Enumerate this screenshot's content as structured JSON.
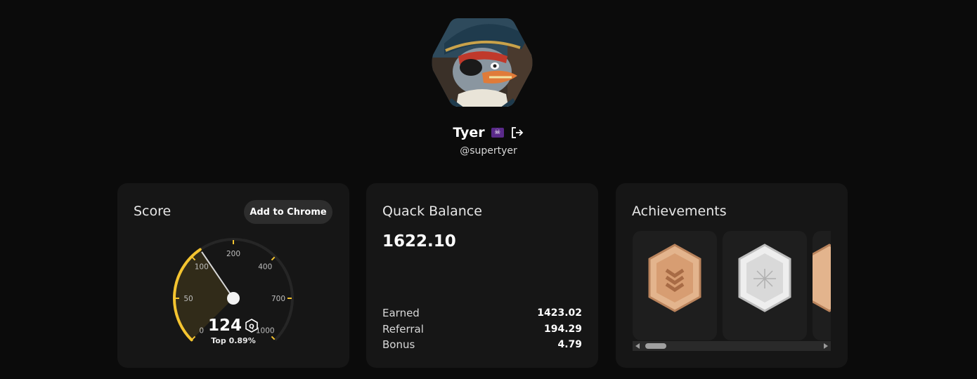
{
  "profile": {
    "name": "Tyer",
    "flag_icon": "pirate-flag-icon",
    "handle": "@supertyer",
    "logout_icon": "logout-icon"
  },
  "score_card": {
    "title": "Score",
    "add_to_chrome_label": "Add to Chrome",
    "gauge": {
      "value": 124,
      "tick_labels": [
        "0",
        "50",
        "100",
        "200",
        "400",
        "700",
        "1000"
      ],
      "accent_color": "#f4c430"
    },
    "score_value": "124",
    "score_icon": "duck-coin-icon",
    "top_percent": "Top 0.89%"
  },
  "balance_card": {
    "title": "Quack Balance",
    "total": "1622.10",
    "rows": [
      {
        "label": "Earned",
        "value": "1423.02"
      },
      {
        "label": "Referral",
        "value": "194.29"
      },
      {
        "label": "Bonus",
        "value": "4.79"
      }
    ]
  },
  "achievements_card": {
    "title": "Achievements",
    "badges": [
      {
        "name": "bronze-rank-badge-icon",
        "color": "#d9a57a"
      },
      {
        "name": "silver-star-badge-icon",
        "color": "#dcdcdc"
      },
      {
        "name": "bronze-badge-partial-icon",
        "color": "#d9a57a"
      }
    ]
  }
}
